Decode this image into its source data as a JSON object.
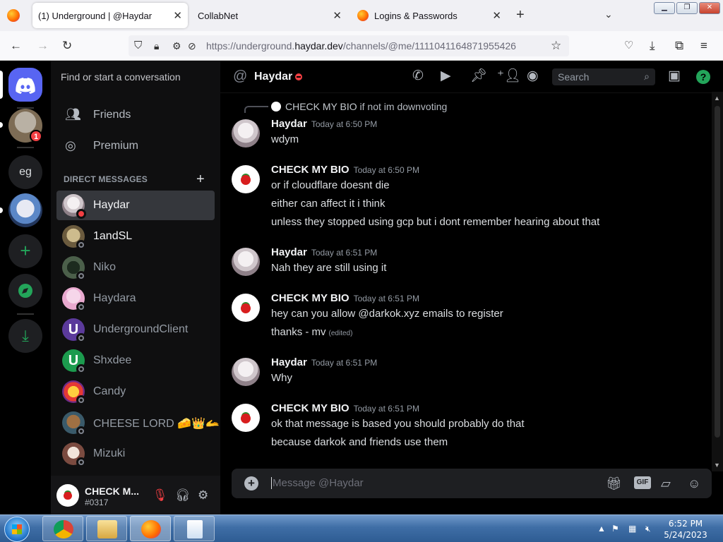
{
  "browser": {
    "tabs": [
      {
        "title": "(1) Underground | @Haydar",
        "active": true
      },
      {
        "title": "CollabNet",
        "active": false
      },
      {
        "title": "Logins & Passwords",
        "active": false
      }
    ],
    "url_prefix": "https://underground.",
    "url_domain": "haydar.dev",
    "url_path": "/channels/@me/1111041164871955426"
  },
  "guilds": {
    "badge_count": "1",
    "eg_label": "eg"
  },
  "dm_panel": {
    "search_placeholder": "Find or start a conversation",
    "friends_label": "Friends",
    "premium_label": "Premium",
    "direct_messages_header": "DIRECT MESSAGES",
    "dms": [
      {
        "name": "Haydar",
        "status": "dnd"
      },
      {
        "name": "1andSL",
        "status": "offline"
      },
      {
        "name": "Niko",
        "status": "offline"
      },
      {
        "name": "Haydara",
        "status": "offline"
      },
      {
        "name": "UndergroundClient",
        "status": "offline"
      },
      {
        "name": "Shxdee",
        "status": "offline"
      },
      {
        "name": "Candy",
        "status": "offline"
      },
      {
        "name": "CHEESE LORD 🧀👑🫴",
        "status": "offline"
      },
      {
        "name": "Mizuki",
        "status": "offline"
      }
    ]
  },
  "user_panel": {
    "username": "CHECK M...",
    "tag": "#0317"
  },
  "chat": {
    "channel_name": "Haydar",
    "search_placeholder": "Search",
    "reply_preview": {
      "author": "CHECK MY BIO",
      "text": "if not im downvoting"
    },
    "messages": [
      {
        "author": "Haydar",
        "time": "Today at 6:50 PM",
        "lines": [
          "wdym"
        ]
      },
      {
        "author": "CHECK MY BIO",
        "time": "Today at 6:50 PM",
        "lines": [
          "or if cloudflare doesnt die",
          "either can affect it i think",
          "unless they stopped using gcp but i dont remember hearing about that"
        ]
      },
      {
        "author": "Haydar",
        "time": "Today at 6:51 PM",
        "lines": [
          "Nah they are still using it"
        ]
      },
      {
        "author": "CHECK MY BIO",
        "time": "Today at 6:51 PM",
        "lines": [
          "hey can you allow @darkok.xyz emails to register",
          "thanks - mv"
        ],
        "edited_label": "(edited)"
      },
      {
        "author": "Haydar",
        "time": "Today at 6:51 PM",
        "lines": [
          "Why"
        ]
      },
      {
        "author": "CHECK MY BIO",
        "time": "Today at 6:51 PM",
        "lines": [
          "ok that message is based you should probably do that",
          "because darkok and friends use them"
        ]
      }
    ],
    "composer_placeholder": "Message @Haydar",
    "gif_label": "GIF"
  },
  "taskbar": {
    "time": "6:52 PM",
    "date": "5/24/2023"
  },
  "colors": {
    "discord_blurple": "#5865f2",
    "dnd_red": "#f23f43",
    "online_green": "#23a55a"
  }
}
